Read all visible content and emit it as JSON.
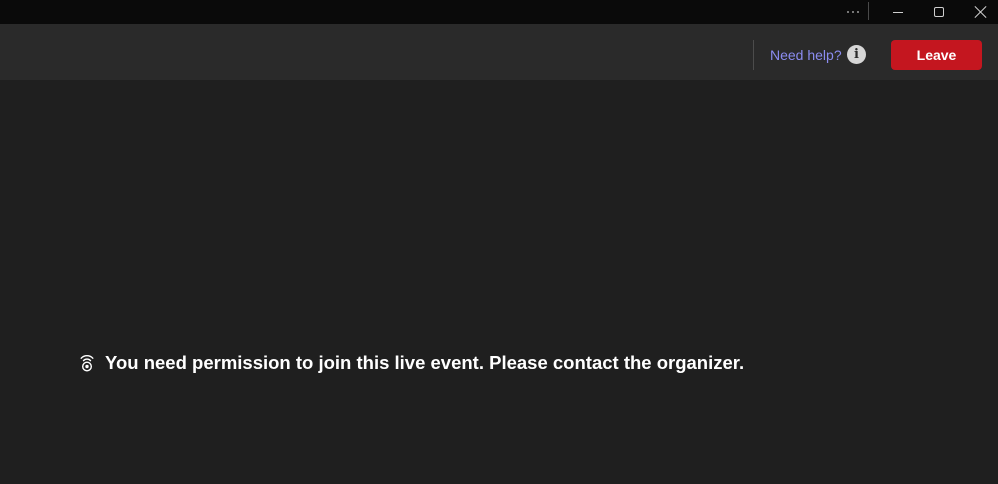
{
  "titlebar": {
    "more_icon": "more-horizontal-icon",
    "minimize_icon": "minimize-icon",
    "maximize_icon": "maximize-icon",
    "close_icon": "close-icon"
  },
  "header": {
    "help_link": "Need help?",
    "info_glyph": "i",
    "leave_button": "Leave",
    "colors": {
      "leave_bg": "#c4161f",
      "link": "#8b8cf0"
    }
  },
  "main": {
    "message": "You need permission to join this live event. Please contact the organizer.",
    "message_icon": "live-broadcast-icon"
  }
}
